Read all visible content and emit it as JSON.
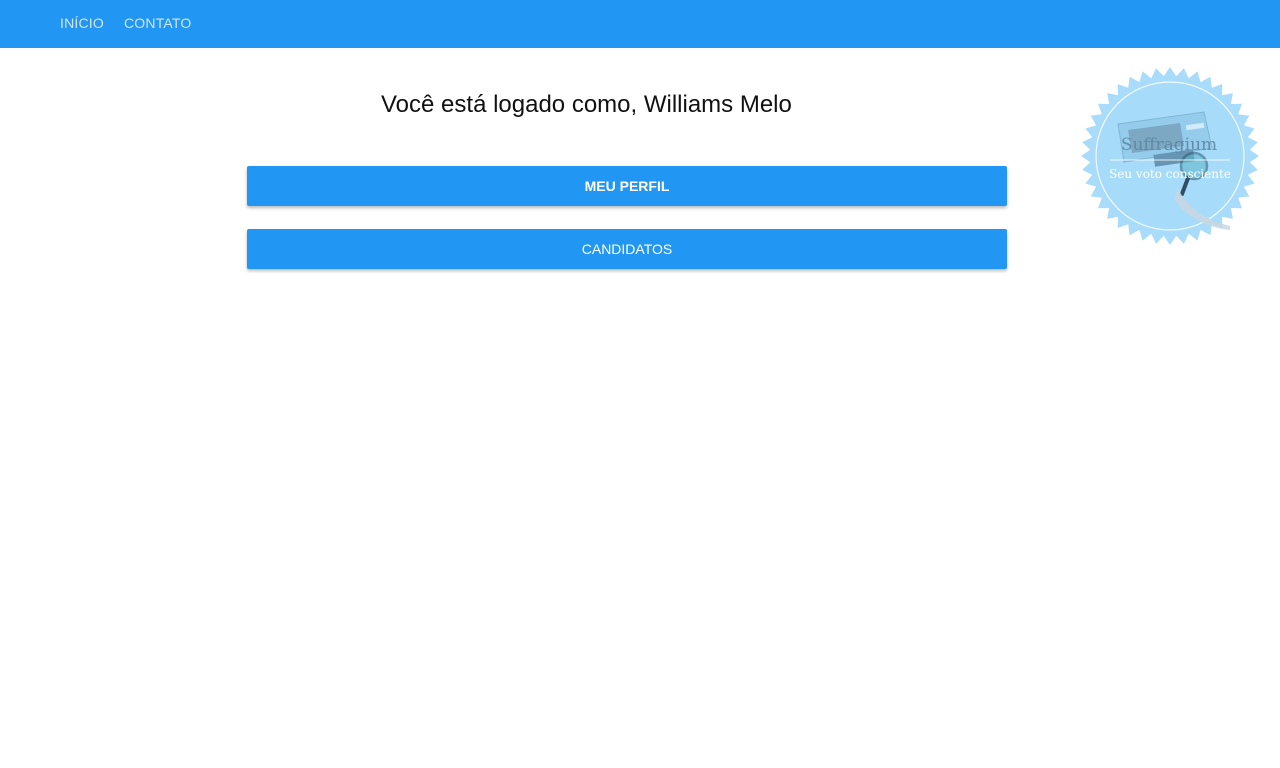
{
  "nav": {
    "items": [
      {
        "label": "INÍCIO"
      },
      {
        "label": "CONTATO"
      }
    ]
  },
  "main": {
    "greeting": "Você está logado como, Williams Melo",
    "buttons": {
      "profile_label": "MEU PERFIL",
      "candidates_label": "CANDIDATOS"
    }
  },
  "logo": {
    "name": "Suffragium",
    "tagline": "Seu voto consciente",
    "icon": "voting-machine-magnifier-icon"
  },
  "colors": {
    "primary": "#2196f3",
    "nav_text": "#cfe6fb",
    "seal": "#a9dcfa"
  }
}
